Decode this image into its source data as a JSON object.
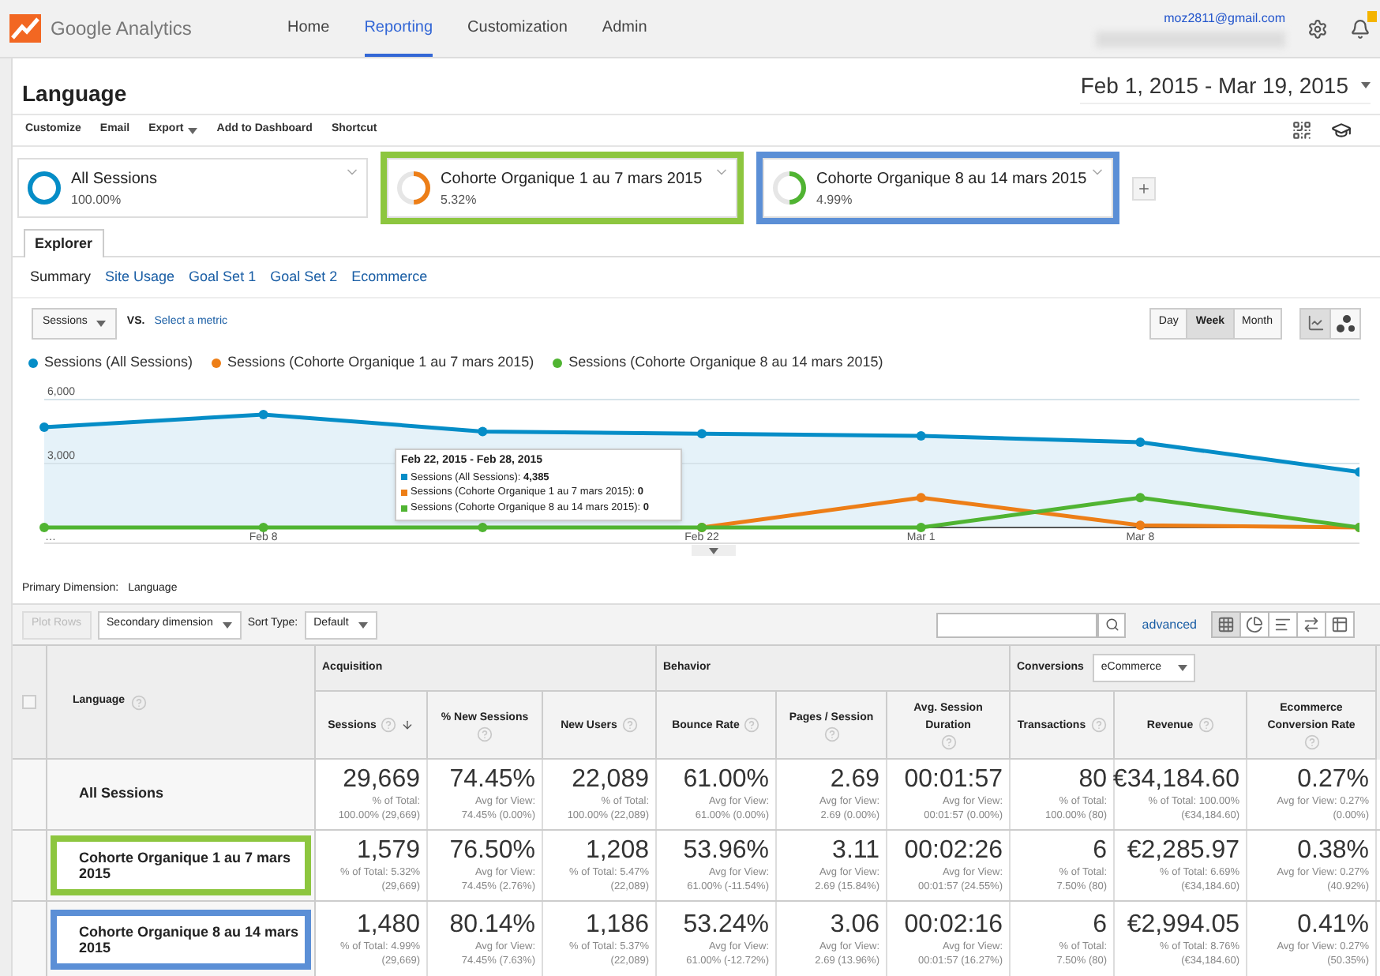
{
  "app": {
    "name": "Google Analytics"
  },
  "nav": [
    {
      "label": "Home",
      "selected": false
    },
    {
      "label": "Reporting",
      "selected": true
    },
    {
      "label": "Customization",
      "selected": false
    },
    {
      "label": "Admin",
      "selected": false
    }
  ],
  "account": {
    "email": "moz2811@gmail.com"
  },
  "page": {
    "title": "Language",
    "date_range": "Feb 1, 2015 - Mar 19, 2015"
  },
  "toolbar": [
    {
      "label": "Customize",
      "dropdown": false
    },
    {
      "label": "Email",
      "dropdown": false
    },
    {
      "label": "Export",
      "dropdown": true
    },
    {
      "label": "Add to Dashboard",
      "dropdown": false
    },
    {
      "label": "Shortcut",
      "dropdown": false
    }
  ],
  "segments": [
    {
      "name": "All Sessions",
      "share": "100.00%",
      "color": "#058dc7"
    },
    {
      "name": "Cohorte Organique 1 au 7 mars 2015",
      "share": "5.32%",
      "color": "#ed7e17",
      "highlight": {
        "color": "#8dc63f"
      }
    },
    {
      "name": "Cohorte Organique 8 au 14 mars 2015",
      "share": "4.99%",
      "color": "#50b432",
      "highlight": {
        "color": "#5b8fd6"
      }
    }
  ],
  "tabs": [
    {
      "label": "Explorer",
      "selected": true
    }
  ],
  "subtabs": [
    {
      "label": "Summary",
      "selected": true
    },
    {
      "label": "Site Usage",
      "selected": false
    },
    {
      "label": "Goal Set 1",
      "selected": false
    },
    {
      "label": "Goal Set 2",
      "selected": false
    },
    {
      "label": "Ecommerce",
      "selected": false
    }
  ],
  "chart_controls": {
    "metric": "Sessions",
    "vs": "VS.",
    "compare_link": "Select a metric",
    "periods": [
      {
        "label": "Day",
        "selected": false
      },
      {
        "label": "Week",
        "selected": true
      },
      {
        "label": "Month",
        "selected": false
      }
    ],
    "views": [
      {
        "kind": "line",
        "selected": true
      },
      {
        "kind": "motion",
        "selected": false
      }
    ]
  },
  "chart": {
    "chart_data": {
      "type": "line",
      "categories": [
        "…",
        "Feb 8",
        null,
        "Feb 22",
        "Mar 1",
        "Mar 8",
        null
      ],
      "ylim": [
        0,
        6000
      ],
      "yticks": [
        {
          "value": 3000,
          "label": "3,000"
        },
        {
          "value": 6000,
          "label": "6,000"
        }
      ],
      "series": [
        {
          "name": "Sessions (All Sessions)",
          "color": "#058dc7",
          "type": "area",
          "marker": "circle",
          "values": [
            4700,
            5300,
            4500,
            4400,
            4300,
            4000,
            2600
          ]
        },
        {
          "name": "Sessions (Cohorte Organique 1 au 7 mars 2015)",
          "color": "#ed7e17",
          "type": "line",
          "marker": "circle",
          "values": [
            null,
            null,
            null,
            0,
            1400,
            100,
            0
          ]
        },
        {
          "name": "Sessions (Cohorte Organique 8 au 14 mars 2015)",
          "color": "#50b432",
          "type": "line",
          "marker": "circle",
          "values": [
            0,
            0,
            0,
            0,
            0,
            1400,
            0
          ]
        }
      ]
    },
    "tooltip": {
      "title": "Feb 22, 2015 - Feb 28, 2015",
      "lines": [
        {
          "text": "Sessions (All Sessions): **4,385**",
          "color": "#058dc7"
        },
        {
          "text": "Sessions (Cohorte Organique 1 au 7 mars 2015): **0**",
          "color": "#ed7e17"
        },
        {
          "text": "Sessions (Cohorte Organique 8 au 14 mars 2015): **0**",
          "color": "#50b432"
        }
      ]
    }
  },
  "primary_dimension": {
    "label": "Primary Dimension:",
    "value": "Language"
  },
  "table_toolbar": {
    "plot_rows": {
      "label": "Plot Rows",
      "disabled": true
    },
    "secondary": "Secondary dimension",
    "sort_label": "Sort Type:",
    "sort_value": "Default",
    "advanced": "advanced",
    "views": [
      {
        "kind": "grid",
        "selected": true
      },
      {
        "kind": "pie",
        "selected": false
      },
      {
        "kind": "bars",
        "selected": false
      },
      {
        "kind": "compare",
        "selected": false
      },
      {
        "kind": "pivot",
        "selected": false
      }
    ]
  },
  "table": {
    "dimension": "Language",
    "select_all": {
      "checked": false
    },
    "groups": [
      {
        "label": "Acquisition",
        "columns": [
          {
            "label": "Sessions",
            "sorted": true
          },
          {
            "label": "% New Sessions",
            "sorted": false
          },
          {
            "label": "New Users",
            "sorted": false
          }
        ]
      },
      {
        "label": "Behavior",
        "columns": [
          {
            "label": "Bounce Rate",
            "sorted": false
          },
          {
            "label": "Pages / Session",
            "sorted": false
          },
          {
            "label": "Avg. Session Duration",
            "sorted": false
          }
        ]
      },
      {
        "label": "Conversions",
        "selector": "eCommerce",
        "columns": [
          {
            "label": "Transactions",
            "sorted": false
          },
          {
            "label": "Revenue",
            "sorted": false
          },
          {
            "label": "Ecommerce Conversion Rate",
            "sorted": false
          }
        ]
      }
    ],
    "rows": [
      {
        "label": "All Sessions",
        "cells": [
          {
            "value": "29,669",
            "note": [
              "% of Total:",
              "100.00% (29,669)"
            ]
          },
          {
            "value": "74.45%",
            "note": [
              "Avg for View:",
              "74.45% (0.00%)"
            ]
          },
          {
            "value": "22,089",
            "note": [
              "% of Total:",
              "100.00% (22,089)"
            ]
          },
          {
            "value": "61.00%",
            "note": [
              "Avg for View:",
              "61.00% (0.00%)"
            ]
          },
          {
            "value": "2.69",
            "note": [
              "Avg for View:",
              "2.69 (0.00%)"
            ]
          },
          {
            "value": "00:01:57",
            "note": [
              "Avg for View:",
              "00:01:57 (0.00%)"
            ]
          },
          {
            "value": "80",
            "note": [
              "% of Total:",
              "100.00% (80)"
            ]
          },
          {
            "value": "€34,184.60",
            "note": [
              "% of Total: 100.00%",
              "(€34,184.60)"
            ]
          },
          {
            "value": "0.27%",
            "note": [
              "Avg for View: 0.27%",
              "(0.00%)"
            ]
          }
        ]
      },
      {
        "label": "Cohorte Organique 1 au 7 mars 2015",
        "highlight": {
          "color": "#8dc63f"
        },
        "cells": [
          {
            "value": "1,579",
            "note": [
              "% of Total: 5.32%",
              "(29,669)"
            ]
          },
          {
            "value": "76.50%",
            "note": [
              "Avg for View:",
              "74.45% (2.76%)"
            ]
          },
          {
            "value": "1,208",
            "note": [
              "% of Total: 5.47%",
              "(22,089)"
            ]
          },
          {
            "value": "53.96%",
            "note": [
              "Avg for View:",
              "61.00% (-11.54%)"
            ]
          },
          {
            "value": "3.11",
            "note": [
              "Avg for View:",
              "2.69 (15.84%)"
            ]
          },
          {
            "value": "00:02:26",
            "note": [
              "Avg for View:",
              "00:01:57 (24.55%)"
            ]
          },
          {
            "value": "6",
            "note": [
              "% of Total:",
              "7.50% (80)"
            ]
          },
          {
            "value": "€2,285.97",
            "note": [
              "% of Total: 6.69%",
              "(€34,184.60)"
            ]
          },
          {
            "value": "0.38%",
            "note": [
              "Avg for View: 0.27%",
              "(40.92%)"
            ]
          }
        ]
      },
      {
        "label": "Cohorte Organique 8 au 14 mars 2015",
        "highlight": {
          "color": "#5b8fd6"
        },
        "cells": [
          {
            "value": "1,480",
            "note": [
              "% of Total: 4.99%",
              "(29,669)"
            ]
          },
          {
            "value": "80.14%",
            "note": [
              "Avg for View:",
              "74.45% (7.63%)"
            ]
          },
          {
            "value": "1,186",
            "note": [
              "% of Total: 5.37%",
              "(22,089)"
            ]
          },
          {
            "value": "53.24%",
            "note": [
              "Avg for View:",
              "61.00% (-12.72%)"
            ]
          },
          {
            "value": "3.06",
            "note": [
              "Avg for View:",
              "2.69 (13.96%)"
            ]
          },
          {
            "value": "00:02:16",
            "note": [
              "Avg for View:",
              "00:01:57 (16.27%)"
            ]
          },
          {
            "value": "6",
            "note": [
              "% of Total:",
              "7.50% (80)"
            ]
          },
          {
            "value": "€2,994.05",
            "note": [
              "% of Total: 8.76%",
              "(€34,184.60)"
            ]
          },
          {
            "value": "0.41%",
            "note": [
              "Avg for View: 0.27%",
              "(50.35%)"
            ]
          }
        ]
      }
    ]
  }
}
